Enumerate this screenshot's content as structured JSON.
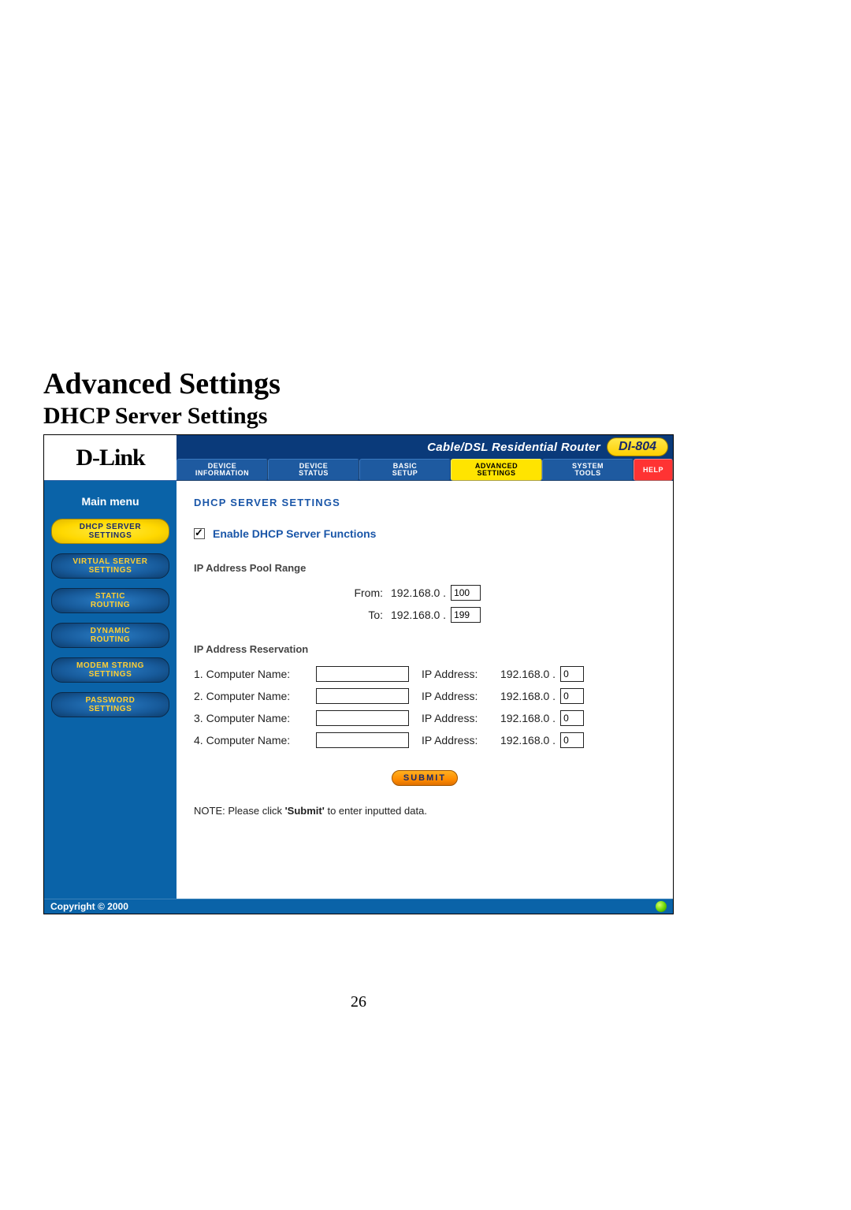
{
  "doc": {
    "title": "Advanced Settings",
    "subtitle": "DHCP Server Settings",
    "page_number": "26"
  },
  "header": {
    "logo_text": "D-Link",
    "banner_label": "Cable/DSL Residential Router",
    "model": "DI-804"
  },
  "tabs": {
    "device_info_l1": "DEVICE",
    "device_info_l2": "INFORMATION",
    "device_status_l1": "DEVICE",
    "device_status_l2": "STATUS",
    "basic_setup_l1": "BASIC",
    "basic_setup_l2": "SETUP",
    "advanced_l1": "ADVANCED",
    "advanced_l2": "SETTINGS",
    "system_tools_l1": "SYSTEM",
    "system_tools_l2": "TOOLS",
    "help": "HELP"
  },
  "sidebar": {
    "title": "Main menu",
    "items": [
      {
        "l1": "DHCP SERVER",
        "l2": "SETTINGS"
      },
      {
        "l1": "VIRTUAL SERVER",
        "l2": "SETTINGS"
      },
      {
        "l1": "STATIC",
        "l2": "ROUTING"
      },
      {
        "l1": "DYNAMIC",
        "l2": "ROUTING"
      },
      {
        "l1": "MODEM STRING",
        "l2": "SETTINGS"
      },
      {
        "l1": "PASSWORD",
        "l2": "SETTINGS"
      }
    ]
  },
  "content": {
    "heading": "DHCP SERVER SETTINGS",
    "enable_label": "Enable DHCP Server Functions",
    "enable_checked": true,
    "pool": {
      "heading": "IP Address Pool Range",
      "from_label": "From:",
      "to_label": "To:",
      "prefix": "192.168.0 .",
      "from_value": "100",
      "to_value": "199"
    },
    "reservation": {
      "heading": "IP Address Reservation",
      "name_label": "Computer Name:",
      "ip_label": "IP Address:",
      "ip_prefix": "192.168.0 .",
      "rows": [
        {
          "num": "1.",
          "name": "",
          "octet": "0"
        },
        {
          "num": "2.",
          "name": "",
          "octet": "0"
        },
        {
          "num": "3.",
          "name": "",
          "octet": "0"
        },
        {
          "num": "4.",
          "name": "",
          "octet": "0"
        }
      ]
    },
    "submit_label": "Submit",
    "note_prefix": "NOTE: Please click ",
    "note_bold": "'Submit'",
    "note_suffix": " to enter inputted data."
  },
  "footer": {
    "copyright": "Copyright © 2000"
  }
}
